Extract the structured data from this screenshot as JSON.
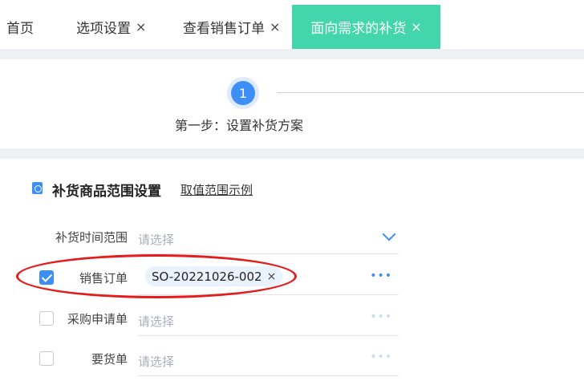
{
  "tabs": [
    {
      "label": "首页",
      "closable": false,
      "active": false
    },
    {
      "label": "选项设置",
      "close": "×",
      "active": false
    },
    {
      "label": "查看销售订单",
      "close": "×",
      "active": false
    },
    {
      "label": "面向需求的补货",
      "close": "×",
      "active": true
    }
  ],
  "steps": {
    "number": "1",
    "label": "第一步：设置补货方案"
  },
  "section": {
    "title": "补货商品范围设置",
    "link": "取值范围示例"
  },
  "form": {
    "time_range": {
      "label": "补货时间范围",
      "placeholder": "请选择"
    },
    "sales_order": {
      "label": "销售订单",
      "checked": true,
      "tag": "SO-20221026-002",
      "tag_close": "×",
      "more": "•••"
    },
    "purchase_request": {
      "label": "采购申请单",
      "checked": false,
      "placeholder": "请选择",
      "more": "•••"
    },
    "demand_order": {
      "label": "要货单",
      "checked": false,
      "placeholder": "请选择",
      "more": "•••"
    }
  },
  "colors": {
    "active_tab": "#43d5ab",
    "primary": "#3d8ef5",
    "annotation": "#e41c1c"
  }
}
